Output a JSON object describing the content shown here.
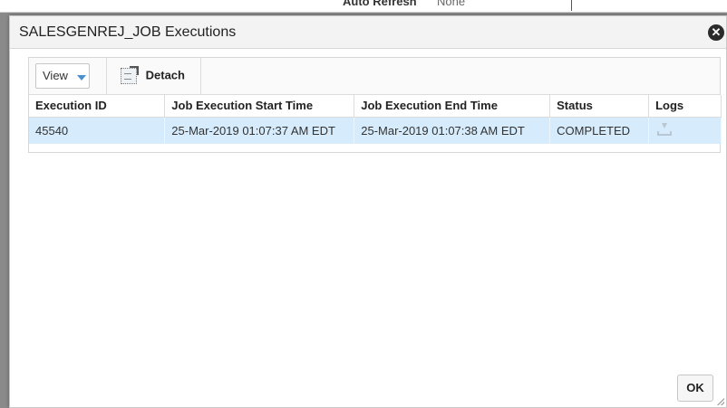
{
  "background": {
    "auto_refresh_label": "Auto Refresh",
    "auto_refresh_value": "None"
  },
  "dialog": {
    "title": "SALESGENREJ_JOB Executions",
    "close_icon": "close-icon",
    "ok_label": "OK"
  },
  "toolbar": {
    "view_label": "View",
    "detach_label": "Detach"
  },
  "table": {
    "columns": [
      "Execution ID",
      "Job Execution Start Time",
      "Job Execution End Time",
      "Status",
      "Logs"
    ],
    "rows": [
      {
        "execution_id": "45540",
        "start_time": "25-Mar-2019 01:07:37 AM EDT",
        "end_time": "25-Mar-2019 01:07:38 AM EDT",
        "status": "COMPLETED",
        "logs_icon": "download-icon"
      }
    ]
  },
  "colors": {
    "selected_row": "#d6ebfb",
    "accent": "#4a90d0"
  }
}
